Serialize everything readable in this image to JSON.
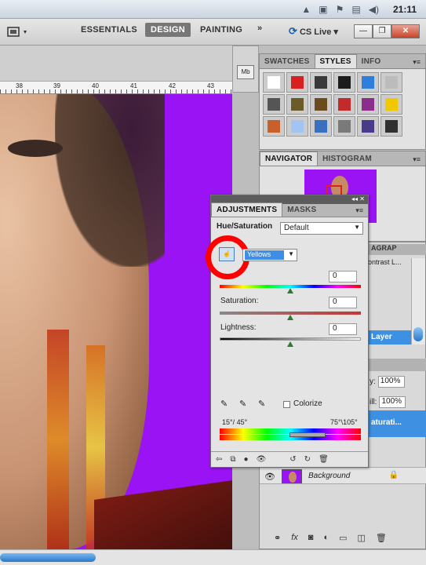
{
  "system_tray": {
    "clock": "21:11"
  },
  "workspace": {
    "essentials": "ESSENTIALS",
    "design": "DESIGN",
    "painting": "PAINTING",
    "more": "»",
    "cslive": "CS Live"
  },
  "ruler": {
    "ticks": [
      "38",
      "39",
      "40",
      "41",
      "42",
      "43"
    ]
  },
  "styles_panel": {
    "tabs": [
      "SWATCHES",
      "STYLES",
      "INFO"
    ],
    "active_tab": "STYLES",
    "swatch_colors": [
      "#ffffff",
      "#d8201e",
      "#3a3a3a",
      "#1c1c1c",
      "#2e7ee0",
      "#bcbcbc",
      "#555555",
      "#6b5a2a",
      "#6b4a1e",
      "#c22b2b",
      "#8b2d8b",
      "#f0c800",
      "#c8602a",
      "#9fc5f0",
      "#3a70c0",
      "#7a7a7a",
      "#4a3a8a",
      "#303030"
    ]
  },
  "navigator_panel": {
    "tabs": [
      "NAVIGATOR",
      "HISTOGRAM"
    ],
    "active_tab": "NAVIGATOR"
  },
  "paragraph_panel": {
    "tab": "AGRAP",
    "contrast_item": "ontrast L...",
    "selected_layer": "Layer"
  },
  "layers_panel": {
    "opacity_label": "y:",
    "opacity_value": "100%",
    "fill_label": "ill:",
    "fill_value": "100%",
    "selected_layer": "aturati...",
    "background_layer": "Background"
  },
  "adjustments_panel": {
    "tabs": [
      "ADJUSTMENTS",
      "MASKS"
    ],
    "active_tab": "ADJUSTMENTS",
    "title": "Hue/Saturation",
    "preset": "Default",
    "channel": "Yellows",
    "hue_value": "0",
    "saturation_label": "Saturation:",
    "saturation_value": "0",
    "lightness_label": "Lightness:",
    "lightness_value": "0",
    "colorize_label": "Colorize",
    "range_left": "15°/ 45°",
    "range_right": "75°\\105°"
  }
}
